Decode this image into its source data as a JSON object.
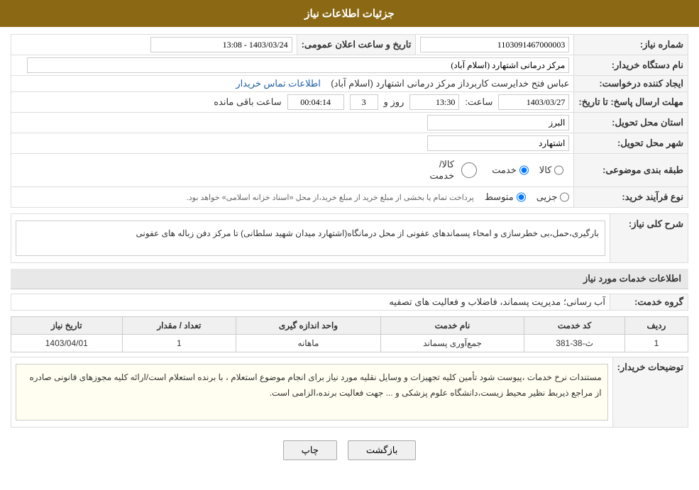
{
  "header": {
    "title": "جزئیات اطلاعات نیاز"
  },
  "fields": {
    "need_number_label": "شماره نیاز:",
    "need_number_value": "1103091467000003",
    "buyer_org_label": "نام دستگاه خریدار:",
    "buyer_org_value": "مرکز درمانی اشتهارد (اسلام آباد)",
    "date_label": "تاریخ و ساعت اعلان عمومی:",
    "date_value": "1403/03/24 - 13:08",
    "creator_label": "ایجاد کننده درخواست:",
    "creator_value": "عباس فتح خدایرست کاربرداز مرکز درمانی اشتهارد (اسلام آباد)",
    "creator_link": "اطلاعات تماس خریدار",
    "deadline_label": "مهلت ارسال پاسخ: تا تاریخ:",
    "deadline_date": "1403/03/27",
    "deadline_time_label": "ساعت:",
    "deadline_time": "13:30",
    "deadline_days_label": "روز و",
    "deadline_days": "3",
    "deadline_remaining_label": "ساعت باقی مانده",
    "deadline_remaining": "00:04:14",
    "province_label": "استان محل تحویل:",
    "province_value": "البرز",
    "city_label": "شهر محل تحویل:",
    "city_value": "اشتهارد",
    "category_label": "طبقه بندی موضوعی:",
    "category_kala": "کالا",
    "category_khedmat": "خدمت",
    "category_kala_khedmat": "کالا/خدمت",
    "process_label": "نوع فرآیند خرید:",
    "process_joz": "جزیی",
    "process_motovaset": "متوسط",
    "process_note": "پرداخت تمام یا بخشی از مبلغ خرید از مبلغ خرید،از محل «اسناد خزانه اسلامی» خواهد بود.",
    "description_label": "شرح کلی نیاز:",
    "description_value": "بارگیری،حمل،بی خطرسازی و امحاء پسماندهای عفونی از محل درمانگاه(اشتهارد میدان شهید سلطانی) تا مرکز دفن زباله های عفونی",
    "services_section_label": "اطلاعات خدمات مورد نیاز",
    "service_group_label": "گروه خدمت:",
    "service_group_value": "آب رسانی؛ مدیریت پسماند، فاضلاب و فعالیت های تصفیه",
    "table_headers": {
      "row_num": "ردیف",
      "service_code": "کد خدمت",
      "service_name": "نام خدمت",
      "unit": "واحد اندازه گیری",
      "quantity": "تعداد / مقدار",
      "date": "تاریخ نیاز"
    },
    "table_rows": [
      {
        "row_num": "1",
        "service_code": "ث-38-381",
        "service_name": "جمع‌آوری پسماند",
        "unit": "ماهانه",
        "quantity": "1",
        "date": "1403/04/01"
      }
    ],
    "buyer_notes_label": "توضیحات خریدار:",
    "buyer_notes_value": "مستندات نرخ خدمات ،پیوست شود تأمین کلیه تجهیزات و وسایل نقلیه مورد نیاز برای انجام موضوع استعلام ، با برنده استعلام است/ارائه کلیه مجوزهای قانونی صادره از مراجع ذیربط نظیر محیط زیست،دانشگاه علوم پزشکی و ... جهت فعالیت برنده،الزامی است.",
    "btn_back": "بازگشت",
    "btn_print": "چاپ"
  }
}
